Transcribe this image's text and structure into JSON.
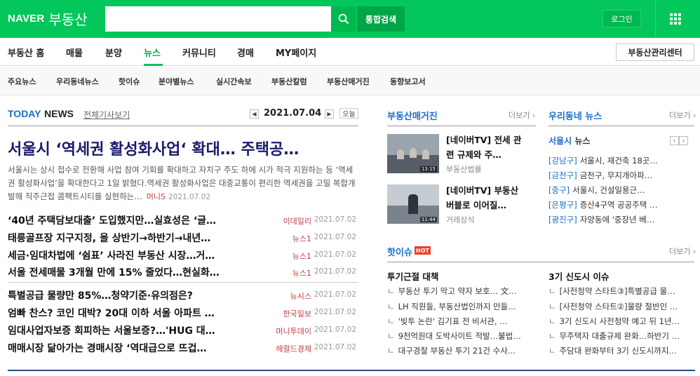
{
  "header": {
    "logo": "NAVER",
    "service": "부동산",
    "search_button": "통합검색",
    "login": "로그인",
    "search_value": ""
  },
  "gnb": {
    "items": [
      "부동산 홈",
      "매물",
      "분양",
      "뉴스",
      "커뮤니티",
      "경매",
      "MY페이지"
    ],
    "active": "뉴스",
    "manager_center": "부동산관리센터"
  },
  "lnb": {
    "items": [
      "주요뉴스",
      "우리동네뉴스",
      "핫이슈",
      "분야별뉴스",
      "실시간속보",
      "부동산칼럼",
      "부동산매거진",
      "동향보고서"
    ]
  },
  "today_news": {
    "title_a": "TODAY",
    "title_b": "NEWS",
    "all_link": "전체기사보기",
    "date": "2021.07.04",
    "today_btn": "오늘",
    "headline": "서울시 ‘역세권 활성화사업‘ 확대… 주택공…",
    "lead_text": "서울시는 상시 접수로 전환해 사업 참여 기회를 확대하고 자치구 주도 하에 시가 적극 지원하는 등 ‘역세권 활성화사업’을 확대한다고 1일 밝혔다.역세권 활성화사업은 대중교통이 편리한 역세권을 고밀 복합개발해 직주근접 콤팩트시티를 실현하는…",
    "lead_source": "머니S",
    "lead_date": "2021.07.02",
    "group1": [
      {
        "title": "‘40년 주택담보대출’ 도입했지만…실효성은 ‘글…",
        "source": "이데일리",
        "date": "2021.07.02"
      },
      {
        "title": "태릉골프장 지구지정, 올 상반기→하반기→내년…",
        "source": "뉴스1",
        "date": "2021.07.02"
      },
      {
        "title": "세금·임대차법에 ‘쉼표’ 사라진 부동산 시장…거…",
        "source": "뉴스1",
        "date": "2021.07.02"
      },
      {
        "title": "서울 전세매물 3개월 만에 15% 줄었다…현실화…",
        "source": "뉴스1",
        "date": "2021.07.02"
      }
    ],
    "group2": [
      {
        "title": "특별공급 물량만 85%…청약기준·유의점은?",
        "source": "뉴시스",
        "date": "2021.07.02"
      },
      {
        "title": "엄빠 찬스? 코인 대박? 20대 이하 서울 아파트 …",
        "source": "한국일보",
        "date": "2021.07.02"
      },
      {
        "title": "임대사업자보증 회피하는 서울보증?…'HUG 대…",
        "source": "머니투데이",
        "date": "2021.07.02"
      },
      {
        "title": "매매시장 닮아가는 경매시장 ‘역대급으로 뜨겁…",
        "source": "헤럴드경제",
        "date": "2021.07.02"
      }
    ]
  },
  "magazine": {
    "title": "부동산매거진",
    "more": "더보기",
    "items": [
      {
        "title": "[네이버TV] 전세 관련 규제와 주…",
        "source": "부동산법률",
        "time": "13:15"
      },
      {
        "title": "[네이버TV] 부동산 버블로 이어질…",
        "source": "거래상식",
        "time": "11:44"
      }
    ]
  },
  "local_news": {
    "title": "우리동네 뉴스",
    "more": "더보기",
    "city": "서울시",
    "kind": "뉴스",
    "items": [
      {
        "region": "[강남구]",
        "text": "서울시, 재건축 18곳…"
      },
      {
        "region": "[금천구]",
        "text": "금천구, 무지개아파…"
      },
      {
        "region": "[중구]",
        "text": "서울시, 건설일용근…"
      },
      {
        "region": "[은평구]",
        "text": "증산4구역 공공주택 …"
      },
      {
        "region": "[광진구]",
        "text": "자양동에 '중장년 베…"
      }
    ]
  },
  "hot_issue": {
    "title": "핫이슈",
    "badge": "HOT",
    "more": "더보기",
    "left_title": "투기근절 대책",
    "left_items": [
      "부동산 투기 막고 약자 보호… 文…",
      "LH 직원들, 부동산법인까지 만들…",
      "'빚투 논란' 김기표 전 비서관, …",
      "9천억원대 도박사이트 적발…불법…",
      "대구경찰 부동산 투기 21건 수사…"
    ],
    "right_title": "3기 신도시 이슈",
    "right_items": [
      "[사전청약 스타트③]특별공급 물…",
      "[사전청약 스타트②]물량 절반인 …",
      "3기 신도시 사전청약 예고 뒤 1년…",
      "무주택자 대출규제 완화…하반기 …",
      "주담대 완화부터 3기 신도시까지…"
    ]
  },
  "colors": {
    "brand_green": "#03c75a",
    "link_blue": "#1c6ec4",
    "source_red": "#c04040",
    "hot_red": "#e8412b"
  },
  "icons": [
    "search-icon",
    "apps-grid-icon",
    "chevron-left-icon",
    "chevron-right-icon"
  ]
}
